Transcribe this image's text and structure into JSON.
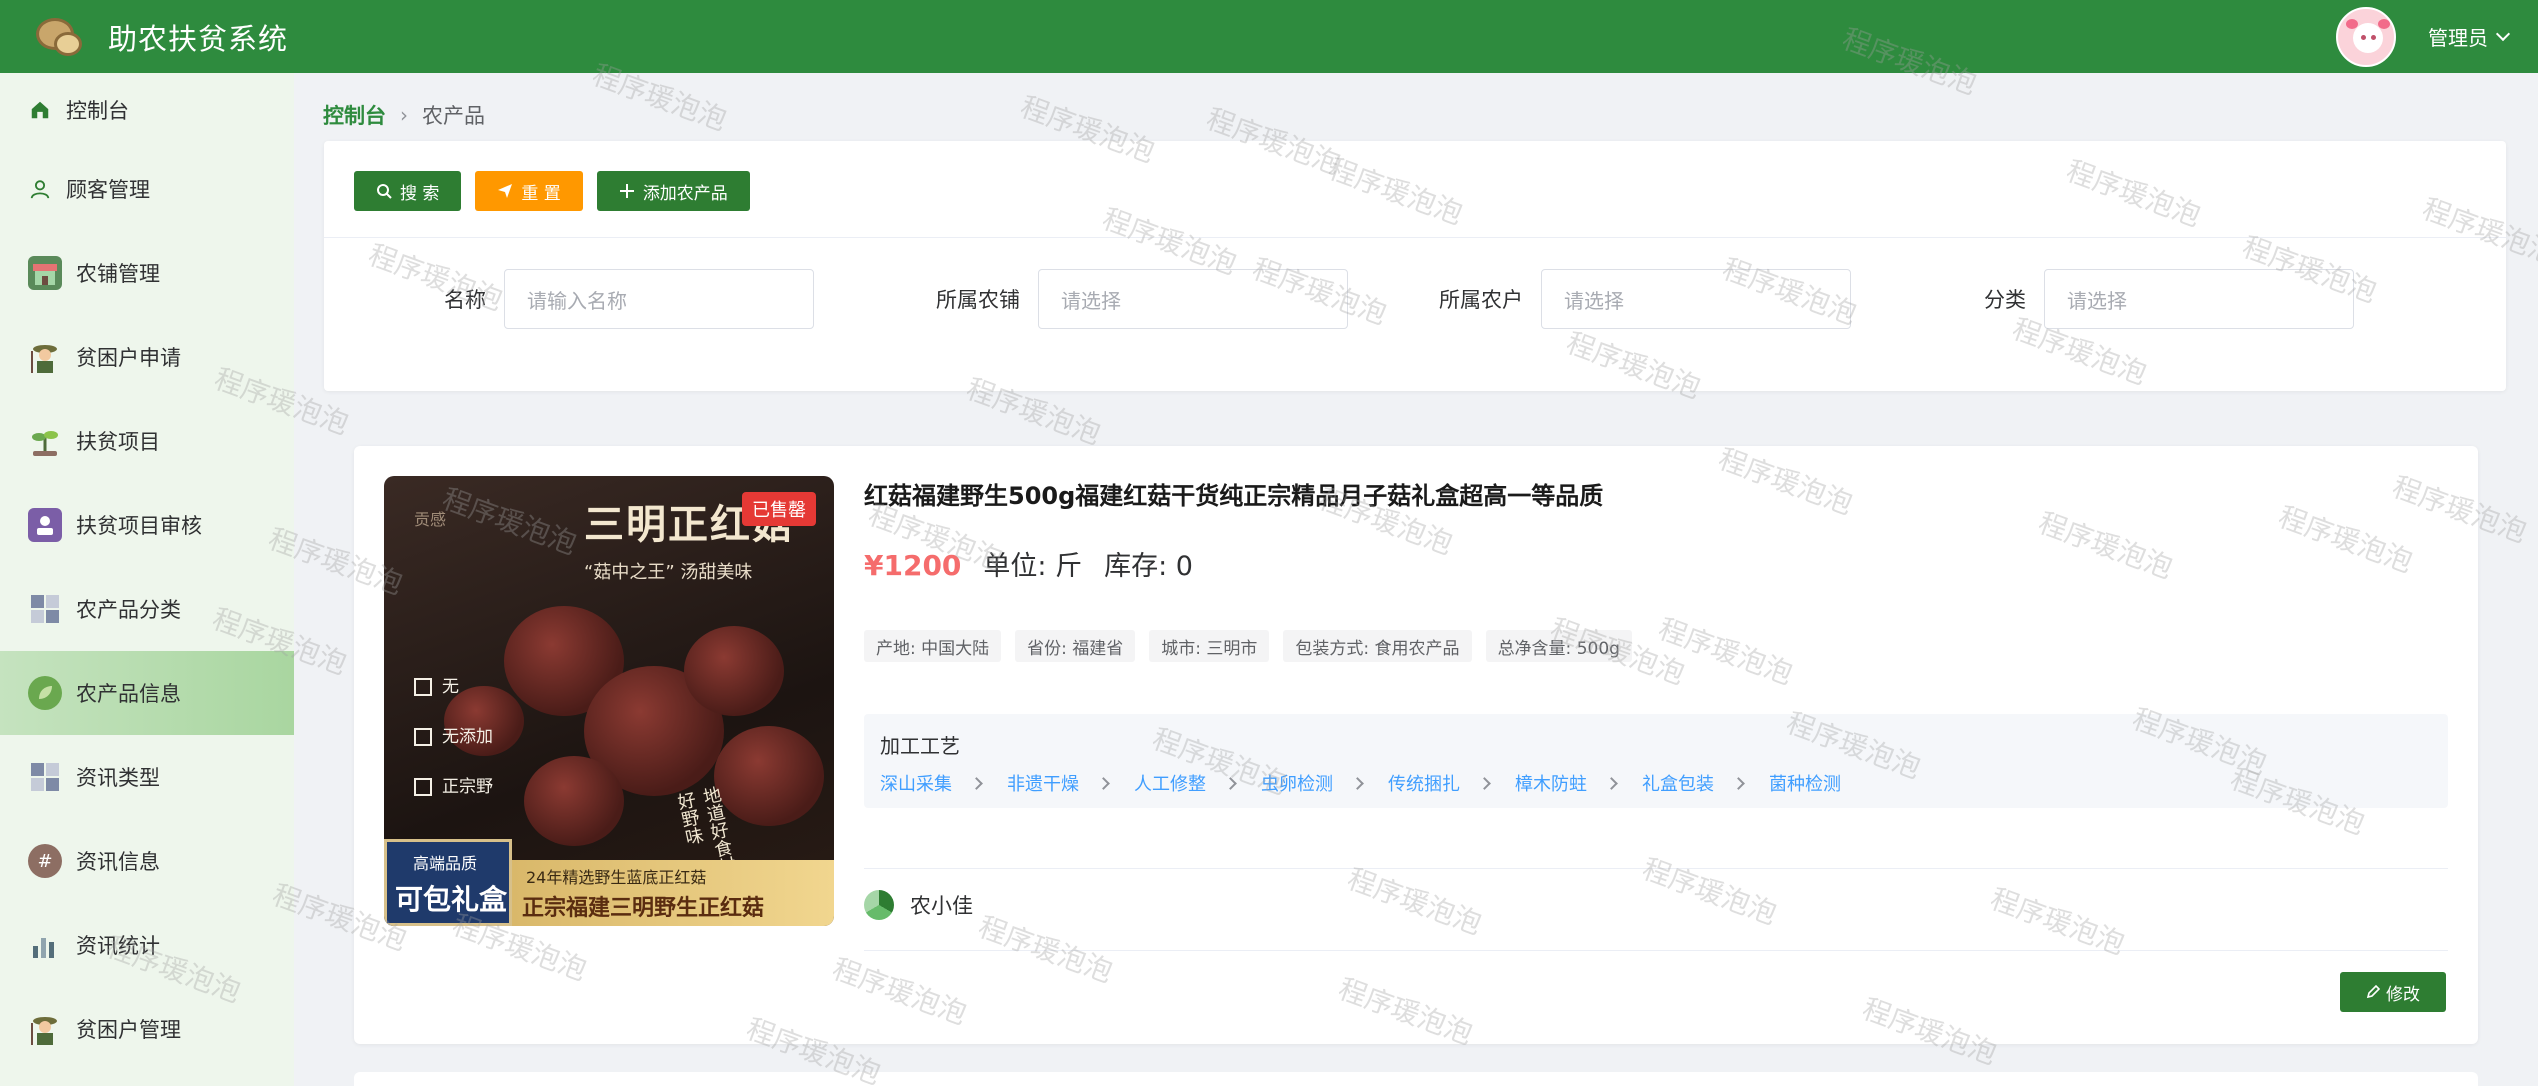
{
  "header": {
    "app_title": "助农扶贫系统",
    "user_name": "管理员"
  },
  "sidebar": {
    "items": [
      {
        "label": "控制台",
        "icon": "home-icon"
      },
      {
        "label": "顾客管理",
        "icon": "user-icon"
      },
      {
        "label": "农铺管理",
        "icon": "shop-icon"
      },
      {
        "label": "贫困户申请",
        "icon": "farmer-icon"
      },
      {
        "label": "扶贫项目",
        "icon": "plant-icon"
      },
      {
        "label": "扶贫项目审核",
        "icon": "audit-icon"
      },
      {
        "label": "农产品分类",
        "icon": "grid-icon"
      },
      {
        "label": "农产品信息",
        "icon": "leaf-icon"
      },
      {
        "label": "资讯类型",
        "icon": "grid-icon"
      },
      {
        "label": "资讯信息",
        "icon": "hash-icon"
      },
      {
        "label": "资讯统计",
        "icon": "bar-chart-icon"
      },
      {
        "label": "贫困户管理",
        "icon": "farmer-icon"
      }
    ],
    "active_index": 7
  },
  "breadcrumb": {
    "home": "控制台",
    "current": "农产品"
  },
  "toolbar": {
    "search_label": "搜 索",
    "reset_label": "重 置",
    "add_label": "添加农产品"
  },
  "filters": [
    {
      "label": "名称",
      "placeholder": "请输入名称"
    },
    {
      "label": "所属农铺",
      "placeholder": "请选择"
    },
    {
      "label": "所属农户",
      "placeholder": "请选择"
    },
    {
      "label": "分类",
      "placeholder": "请选择"
    }
  ],
  "product": {
    "title": "红菇福建野生500g福建红菇干货纯正宗精品月子菇礼盒超高一等品质",
    "price": "¥1200",
    "unit": "单位: 斤",
    "stock": "库存: 0",
    "sold_badge": "已售罄",
    "tags": [
      "产地: 中国大陆",
      "省份: 福建省",
      "城市: 三明市",
      "包装方式: 食用农产品",
      "总净含量: 500g"
    ],
    "process_title": "加工工艺",
    "process_steps": [
      "深山采集",
      "非遗干燥",
      "人工修整",
      "虫卵检测",
      "传统捆扎",
      "樟木防蛀",
      "礼盒包装",
      "菌种检测"
    ],
    "shop_name": "农小佳",
    "edit_label": "修改",
    "image_text": {
      "brand": "贡感",
      "headline": "三明正红菇",
      "slogan": "“菇中之王” 汤甜美味",
      "checks": [
        "无",
        "无添加",
        "正宗野"
      ],
      "badge_small": "高端品质",
      "badge_big": "可包礼盒",
      "strip_top": "24年精选野生蓝底正红菇",
      "strip_bottom": "正宗福建三明野生正红菇",
      "vertical": "地道好食材 正宗好野味"
    }
  },
  "watermark": "程序瑗泡泡",
  "colors": {
    "header": "#2e8b3e",
    "accent": "#2e7d32",
    "orange": "#ff9800",
    "price": "#f56c6c",
    "link": "#409eff"
  }
}
